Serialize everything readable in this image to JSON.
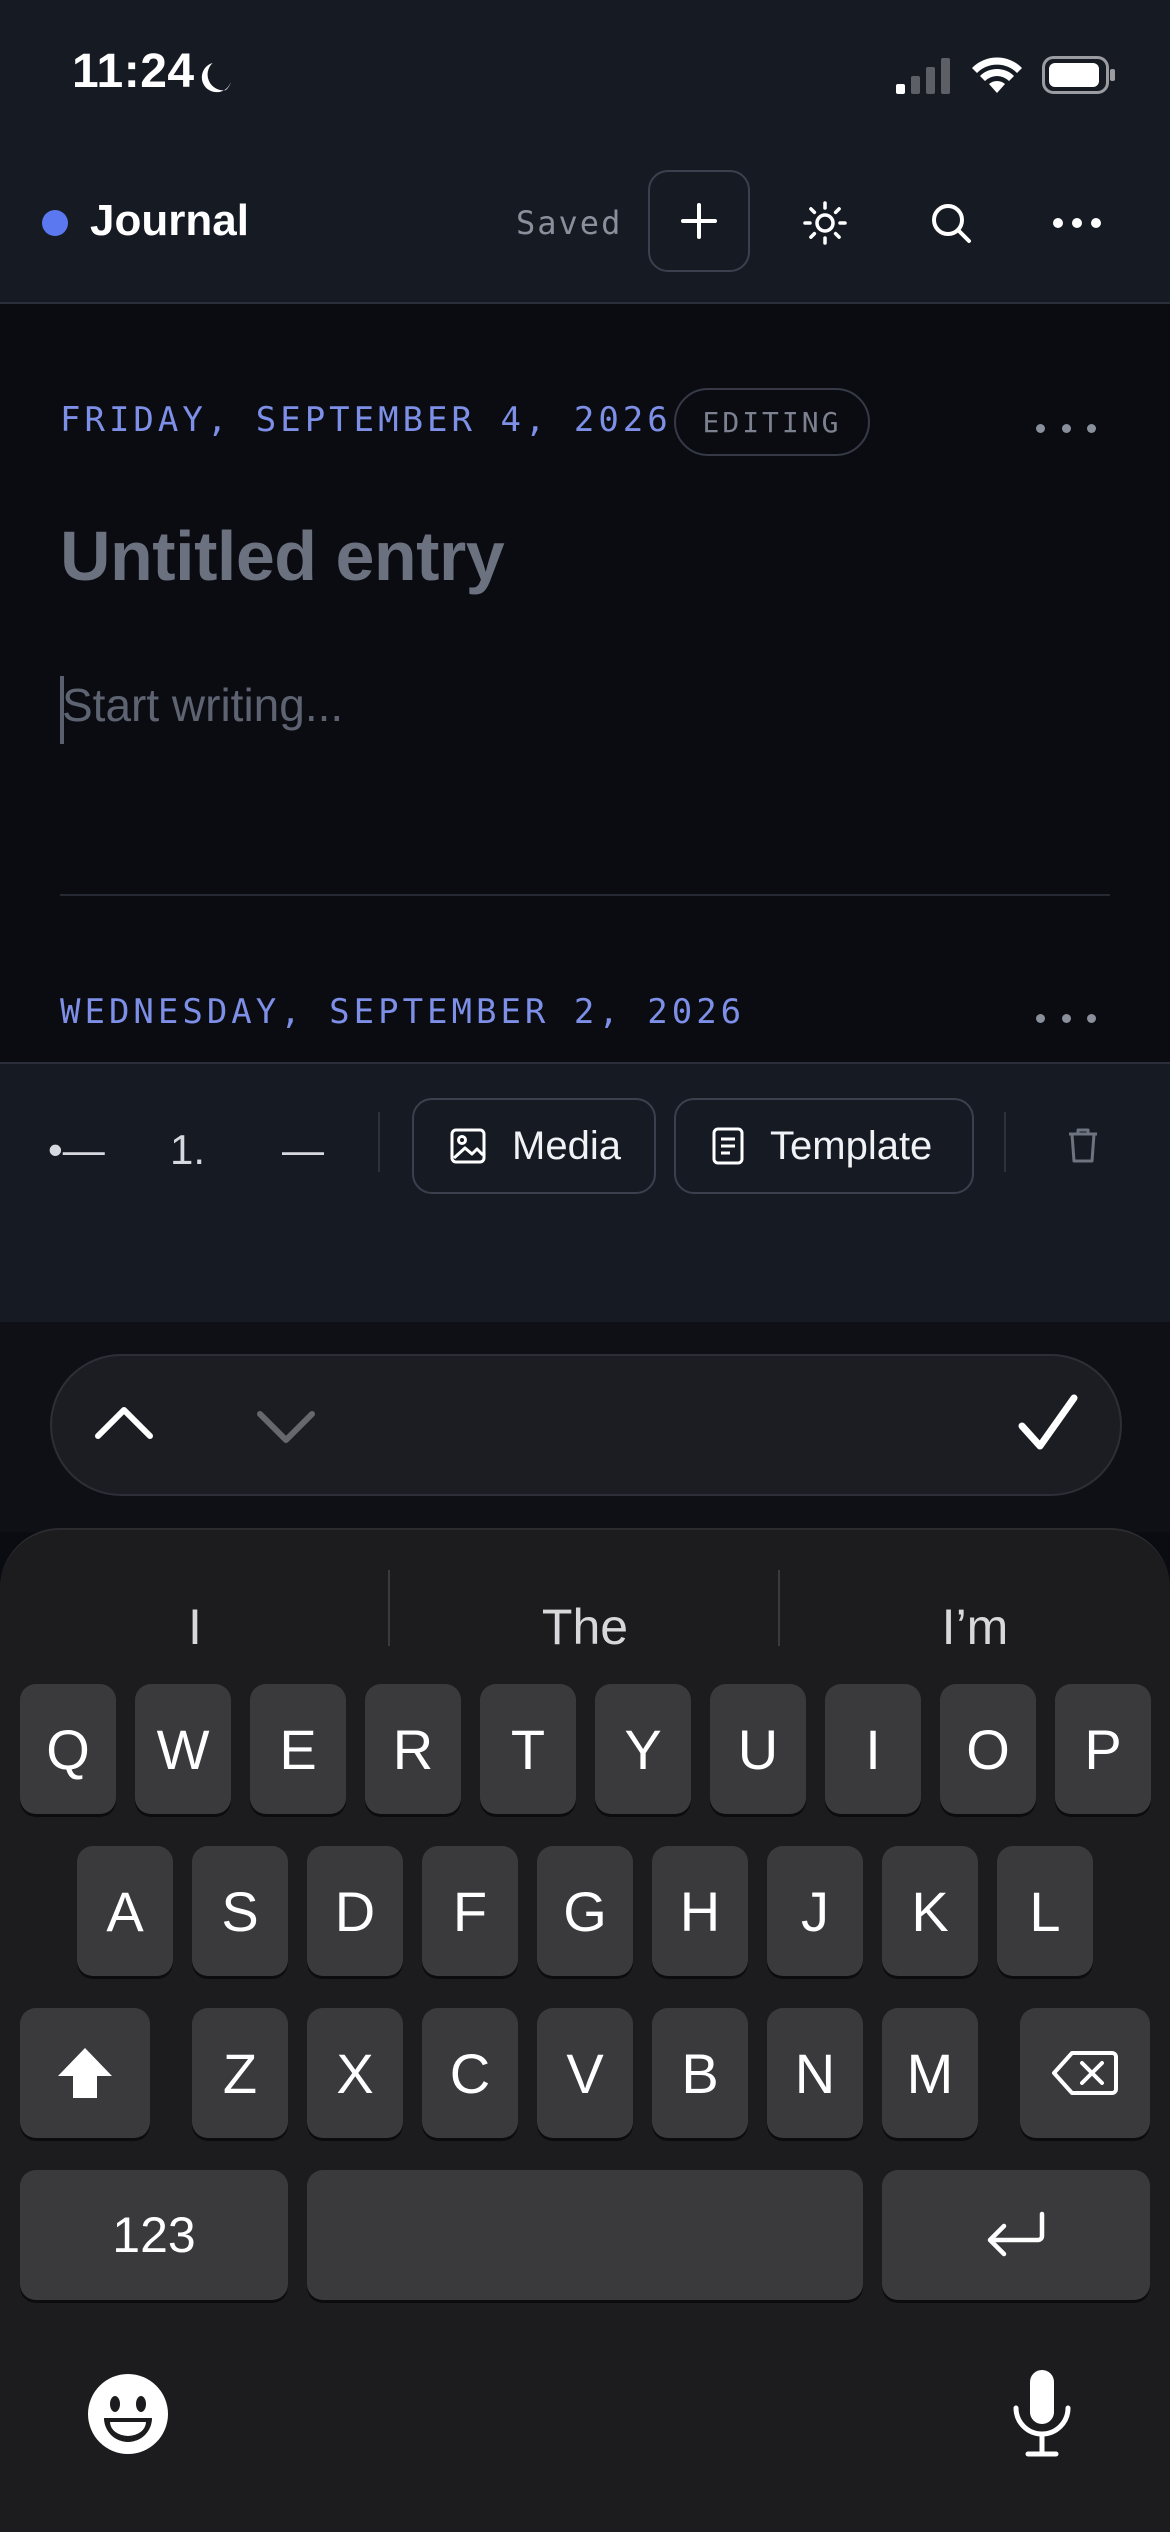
{
  "status_bar": {
    "time": "11:24"
  },
  "header": {
    "title": "Journal",
    "saved_label": "Saved",
    "accent_color": "#5b78f0"
  },
  "entries": [
    {
      "date": "FRIDAY, SEPTEMBER 4, 2026",
      "badge": "EDITING",
      "title_placeholder": "Untitled entry",
      "body_placeholder": "Start writing..."
    },
    {
      "date": "WEDNESDAY, SEPTEMBER 2, 2026"
    }
  ],
  "toolbar": {
    "bullet_list": "•—",
    "numbered_list": "1.",
    "dash": "—",
    "media_label": "Media",
    "template_label": "Template"
  },
  "keyboard": {
    "suggestions": [
      "I",
      "The",
      "I’m"
    ],
    "row1": [
      "Q",
      "W",
      "E",
      "R",
      "T",
      "Y",
      "U",
      "I",
      "O",
      "P"
    ],
    "row2": [
      "A",
      "S",
      "D",
      "F",
      "G",
      "H",
      "J",
      "K",
      "L"
    ],
    "row3": [
      "Z",
      "X",
      "C",
      "V",
      "B",
      "N",
      "M"
    ],
    "numbers_label": "123"
  }
}
